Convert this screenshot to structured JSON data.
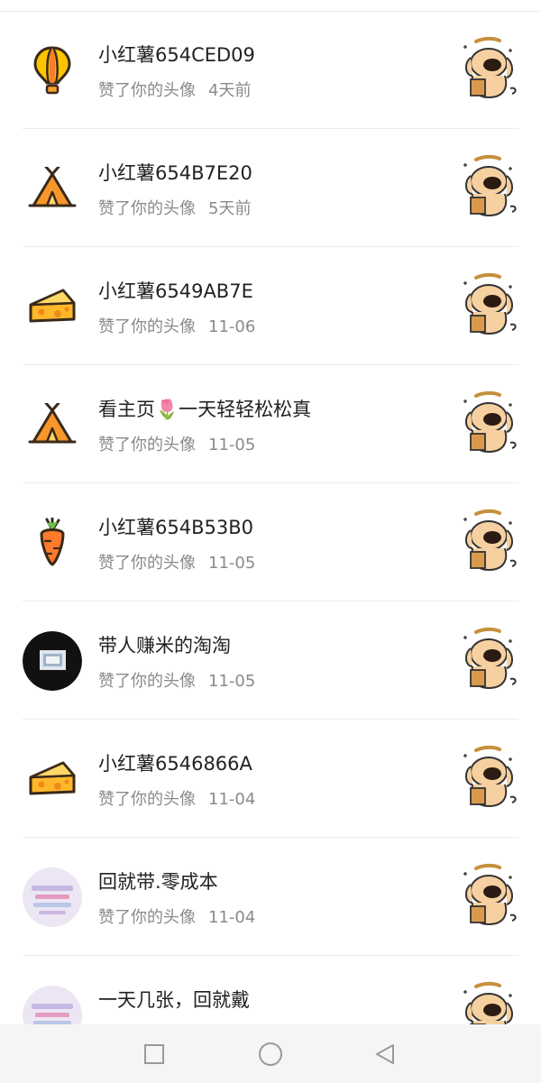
{
  "colors": {
    "name_text": "#222222",
    "secondary_text": "#8a8a8a",
    "divider": "#ececec",
    "nav_bg": "#f5f5f5",
    "icon_orange": "#f7a12a",
    "icon_outline": "#3a2a1a"
  },
  "notifications": [
    {
      "name": "小红薯654CED09",
      "action": "赞了你的头像",
      "time": "4天前",
      "avatar_icon": "hot-air-balloon-icon"
    },
    {
      "name": "小红薯654B7E20",
      "action": "赞了你的头像",
      "time": "5天前",
      "avatar_icon": "tent-icon"
    },
    {
      "name": "小红薯6549AB7E",
      "action": "赞了你的头像",
      "time": "11-06",
      "avatar_icon": "cheese-icon"
    },
    {
      "name": "看主页🌷一天轻轻松松真",
      "action": "赞了你的头像",
      "time": "11-05",
      "avatar_icon": "tent-icon"
    },
    {
      "name": "小红薯654B53B0",
      "action": "赞了你的头像",
      "time": "11-05",
      "avatar_icon": "carrot-icon"
    },
    {
      "name": "带人赚米的淘淘",
      "action": "赞了你的头像",
      "time": "11-05",
      "avatar_icon": "dark-photo-avatar"
    },
    {
      "name": "小红薯6546866A",
      "action": "赞了你的头像",
      "time": "11-04",
      "avatar_icon": "cheese-icon"
    },
    {
      "name": "回就带.零成本",
      "action": "赞了你的头像",
      "time": "11-04",
      "avatar_icon": "photo-avatar"
    },
    {
      "name": "一天几张，回就戴",
      "action": "",
      "time": "",
      "avatar_icon": "photo-avatar"
    }
  ],
  "thumbnail_icon": "dog-sticker-icon",
  "nav": {
    "recent_icon": "square-icon",
    "home_icon": "circle-icon",
    "back_icon": "triangle-back-icon"
  }
}
